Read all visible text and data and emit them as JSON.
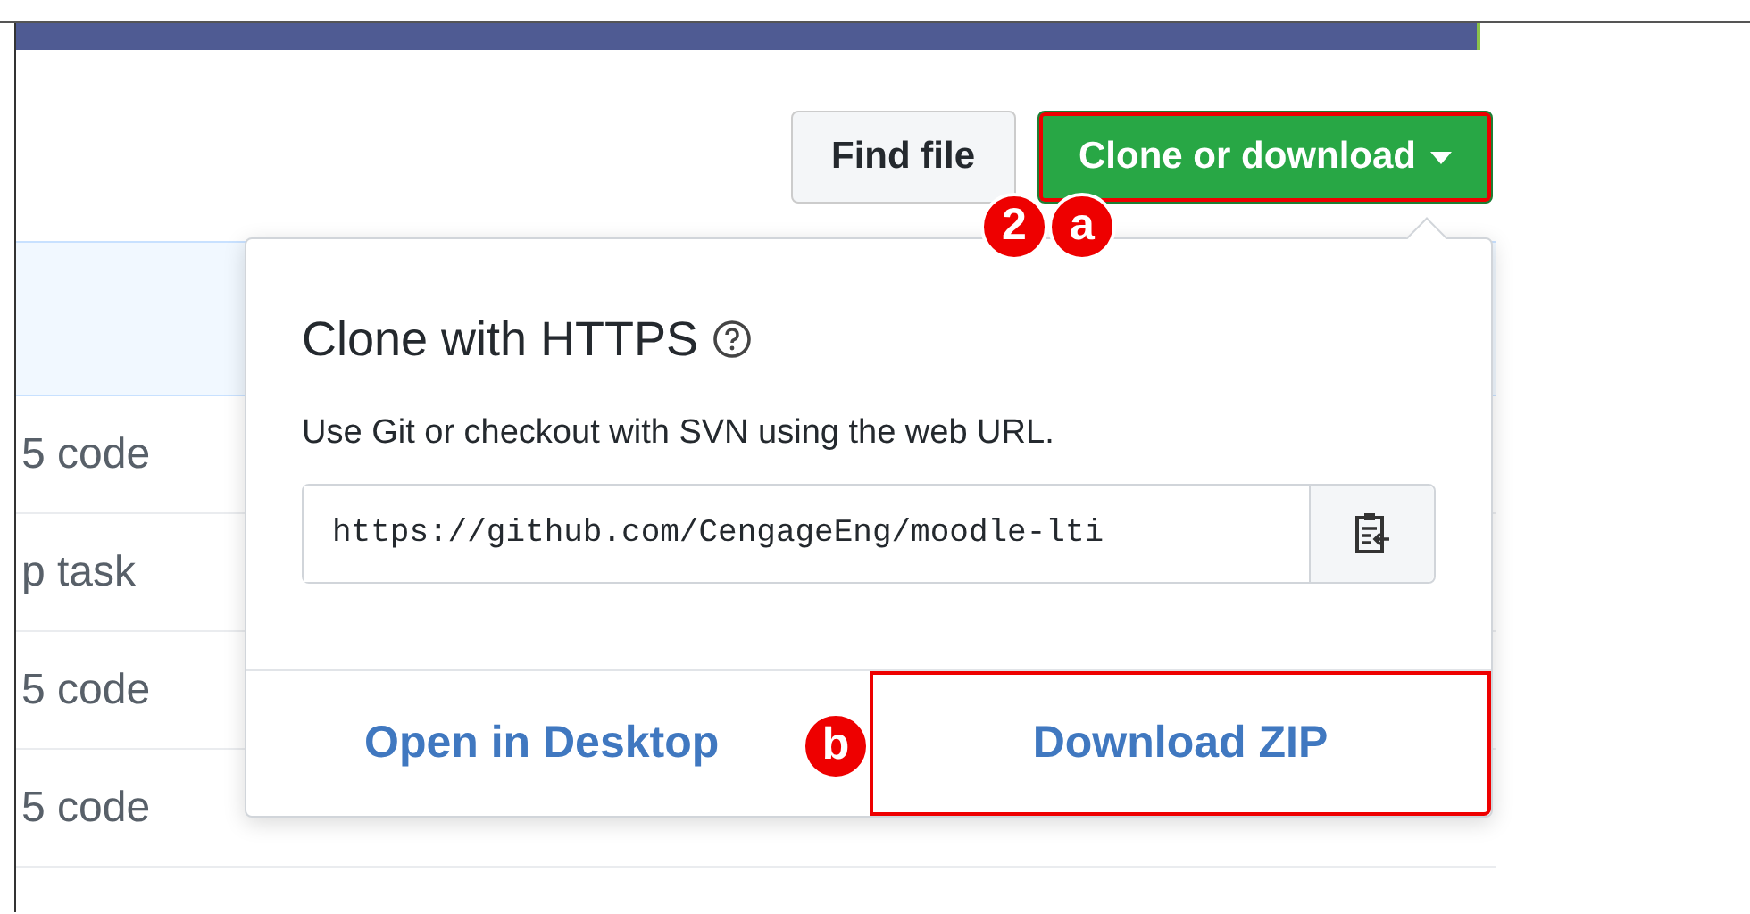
{
  "top_buttons": [
    {
      "label": "Find file",
      "kind": "default",
      "highlighted": false
    },
    {
      "label": "Clone or download",
      "kind": "primary",
      "highlighted": true
    }
  ],
  "file_rows": [
    {
      "message": "5 code"
    },
    {
      "message": "p task"
    },
    {
      "message": "5 code"
    },
    {
      "message": "5 code"
    }
  ],
  "popover": {
    "title": "Clone with HTTPS",
    "description": "Use Git or checkout with SVN using the web URL.",
    "url": "https://github.com/CengageEng/moodle-lti",
    "actions": [
      {
        "label": "Open in Desktop",
        "highlighted": false
      },
      {
        "label": "Download ZIP",
        "highlighted": true
      }
    ]
  },
  "markers": [
    {
      "label": "2"
    },
    {
      "label": "a"
    },
    {
      "label": "b"
    }
  ]
}
